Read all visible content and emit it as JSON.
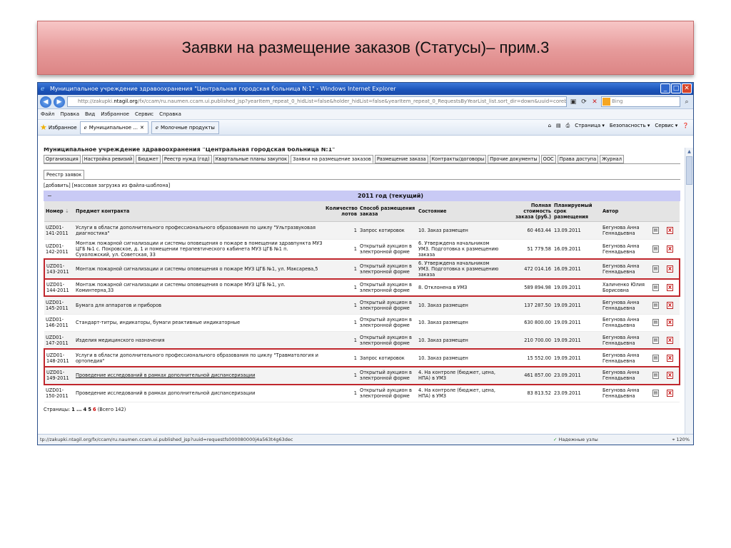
{
  "slide": {
    "title": "Заявки на размещение заказов (Статусы)– прим.3"
  },
  "browser": {
    "window_title": "Муниципальное учреждение здравоохранения \"Центральная городская больница N:1\" - Windows Internet Explorer",
    "url_prefix": "http://zakupki.",
    "url_domain": "ntagil.org",
    "url_rest": "/fx/ccam/ru.naumen.ccam.ui.published_jsp?yearItem_repeat_0_hidList=false&holder_hidList=false&yearItem_repeat_0_RequestsByYearList_list.sort_dir=down&uuid=corebofs0000",
    "search_placeholder": "Bing",
    "menu": [
      "Файл",
      "Правка",
      "Вид",
      "Избранное",
      "Сервис",
      "Справка"
    ],
    "favorites_label": "Избранное",
    "tabs": [
      "Муниципальное ...",
      "Молочные продукты"
    ],
    "toolbar_right": [
      "Страница ▾",
      "Безопасность ▾",
      "Сервис ▾"
    ],
    "status_url": "tp://zakupki.ntagil.org/fx/ccam/ru.naumen.ccam.ui.published_jsp?uuid=requestfs000080000j4a563t4g63dec",
    "status_zone": "Надежные узлы",
    "status_zoom": "120%"
  },
  "page": {
    "org_title": "Муниципальное учреждение здравоохранения \"Центральная городская больница N:1\"",
    "tabs": [
      "Организация",
      "Настройка ревизий",
      "Бюджет",
      "Реестр нужд (год)",
      "Квартальные планы закупок",
      "Заявки на размещение заказов",
      "Размещение заказа",
      "Контракты/договоры",
      "Прочие документы",
      "ООС",
      "Права доступа",
      "Журнал"
    ],
    "active_tab": "Заявки на размещение заказов",
    "subtab": "Реестр заявок",
    "add_link": "[добавить]",
    "bulk_link": "[массовая загрузка из файла-шаблона]",
    "year_label": "2011 год (текущий)",
    "year_toggle": "−",
    "columns": {
      "number": "Номер",
      "subject": "Предмет контракта",
      "lots": "Количество лотов",
      "method": "Способ размещения заказа",
      "state": "Состояние",
      "cost": "Полная стоимость заказа (руб.)",
      "date": "Планируемый срок размещения",
      "author": "Автор"
    },
    "rows": [
      {
        "number": "UZD01-141-2011",
        "subject": "Услуги в области дополнительного профессионального образования по циклу \"Ультразвуковая диагностика\"",
        "lots": "1",
        "method": "Запрос котировок",
        "state": "10. Заказ размещен",
        "cost": "60 463.44",
        "date": "13.09.2011",
        "author": "Бегунова Анна Геннадьевна",
        "highlight": false
      },
      {
        "number": "UZD01-142-2011",
        "subject": "Монтаж пожарной сигнализации и системы оповещения о пожаре в помещении здравпункта МУЗ ЦГБ №1 с. Покровское, д. 1 и помещении терапевтического кабинета МУЗ ЦГБ №1 п. Сухоложский, ул. Советская, 33",
        "lots": "1",
        "method": "Открытый аукцион в электронной форме",
        "state": "6. Утверждена начальником УМЗ. Подготовка к размещению заказа",
        "cost": "51 779.58",
        "date": "16.09.2011",
        "author": "Бегунова Анна Геннадьевна",
        "highlight": false
      },
      {
        "number": "UZD01-143-2011",
        "subject": "Монтаж пожарной сигнализации и системы оповещения о пожаре МУЗ ЦГБ №1, ул. Максарева,5",
        "lots": "1",
        "method": "Открытый аукцион в электронной форме",
        "state": "6. Утверждена начальником УМЗ. Подготовка к размещению заказа",
        "cost": "472 014.16",
        "date": "16.09.2011",
        "author": "Бегунова Анна Геннадьевна",
        "highlight": true
      },
      {
        "number": "UZD01-144-2011",
        "subject": "Монтаж пожарной сигнализации и системы оповещения о пожаре МУЗ ЦГБ №1, ул. Коминтерна,33",
        "lots": "1",
        "method": "Открытый аукцион в электронной форме",
        "state": "8. Отклонена в УМЗ",
        "cost": "589 894.98",
        "date": "19.09.2011",
        "author": "Халиченко Юлия Борисовна",
        "highlight": true
      },
      {
        "number": "UZD01-145-2011",
        "subject": "Бумага для аппаратов и приборов",
        "lots": "1",
        "method": "Открытый аукцион в электронной форме",
        "state": "10. Заказ размещен",
        "cost": "137 287.50",
        "date": "19.09.2011",
        "author": "Бегунова Анна Геннадьевна",
        "highlight": false
      },
      {
        "number": "UZD01-146-2011",
        "subject": "Стандарт-титры, индикаторы, бумаги реактивные индикаторные",
        "lots": "1",
        "method": "Открытый аукцион в электронной форме",
        "state": "10. Заказ размещен",
        "cost": "630 800.00",
        "date": "19.09.2011",
        "author": "Бегунова Анна Геннадьевна",
        "highlight": false
      },
      {
        "number": "UZD01-147-2011",
        "subject": "Изделия медицинского назначения",
        "lots": "1",
        "method": "Открытый аукцион в электронной форме",
        "state": "10. Заказ размещен",
        "cost": "210 700.00",
        "date": "19.09.2011",
        "author": "Бегунова Анна Геннадьевна",
        "highlight": false
      },
      {
        "number": "UZD01-148-2011",
        "subject": "Услуги в области дополнительного профессионального образования по циклу \"Травматология и ортопедия\"",
        "lots": "1",
        "method": "Запрос котировок",
        "state": "10. Заказ размещен",
        "cost": "15 552.00",
        "date": "19.09.2011",
        "author": "Бегунова Анна Геннадьевна",
        "highlight": true
      },
      {
        "number": "UZD01-149-2011",
        "subject": "Проведение исследований в рамках дополнительной диспансеризации",
        "lots": "1",
        "method": "Открытый аукцион в электронной форме",
        "state": "4. На контроле (бюджет, цена, НПА) в УМЗ",
        "cost": "461 857.00",
        "date": "23.09.2011",
        "author": "Бегунова Анна Геннадьевна",
        "highlight": true
      },
      {
        "number": "UZD01-150-2011",
        "subject": "Проведение исследований в рамках дополнительной диспансеризации",
        "lots": "1",
        "method": "Открытый аукцион в электронной форме",
        "state": "4. На контроле (бюджет, цена, НПА) в УМЗ",
        "cost": "83 813.52",
        "date": "23.09.2011",
        "author": "Бегунова Анна Геннадьевна",
        "highlight": false
      }
    ],
    "pager": {
      "label": "Страницы:",
      "first": "1",
      "ellipsis": "...",
      "p4": "4",
      "p5": "5",
      "current": "6",
      "total": "(Всего 142)"
    }
  }
}
